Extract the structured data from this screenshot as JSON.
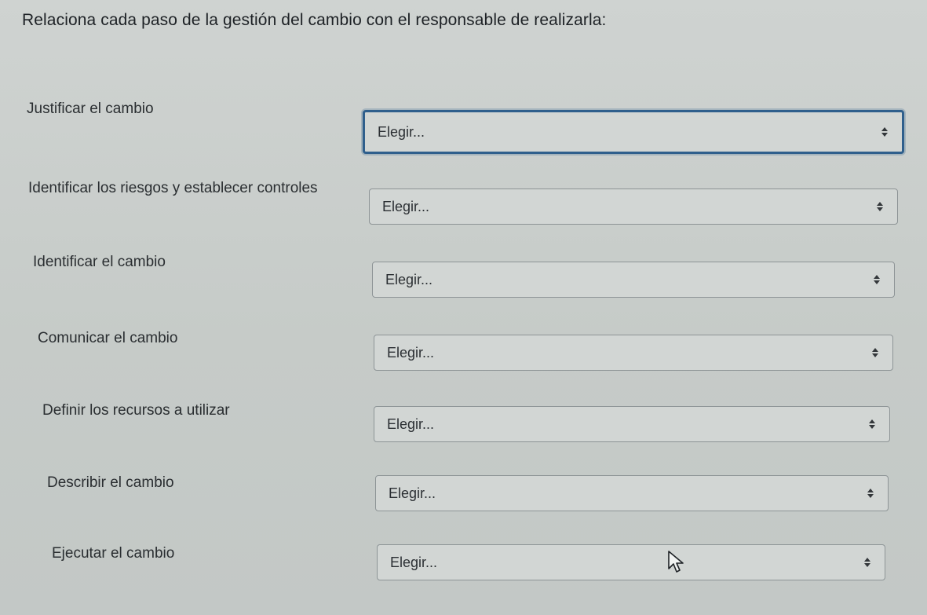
{
  "prompt": "Relaciona cada paso de la gestión del cambio con el responsable de realizarla:",
  "rows": [
    {
      "label": "Justificar el cambio",
      "select_value": "Elegir..."
    },
    {
      "label": "Identificar los riesgos y establecer controles",
      "select_value": "Elegir..."
    },
    {
      "label": "Identificar el cambio",
      "select_value": "Elegir..."
    },
    {
      "label": "Comunicar el cambio",
      "select_value": "Elegir..."
    },
    {
      "label": "Definir los recursos a utilizar",
      "select_value": "Elegir..."
    },
    {
      "label": "Describir el cambio",
      "select_value": "Elegir..."
    },
    {
      "label": "Ejecutar el cambio",
      "select_value": "Elegir..."
    }
  ],
  "icons": {
    "caret": "up-down-caret-icon",
    "cursor": "mouse-pointer-icon"
  },
  "colors": {
    "focus_border": "#2f5f8c",
    "background": "#c9cecb"
  }
}
